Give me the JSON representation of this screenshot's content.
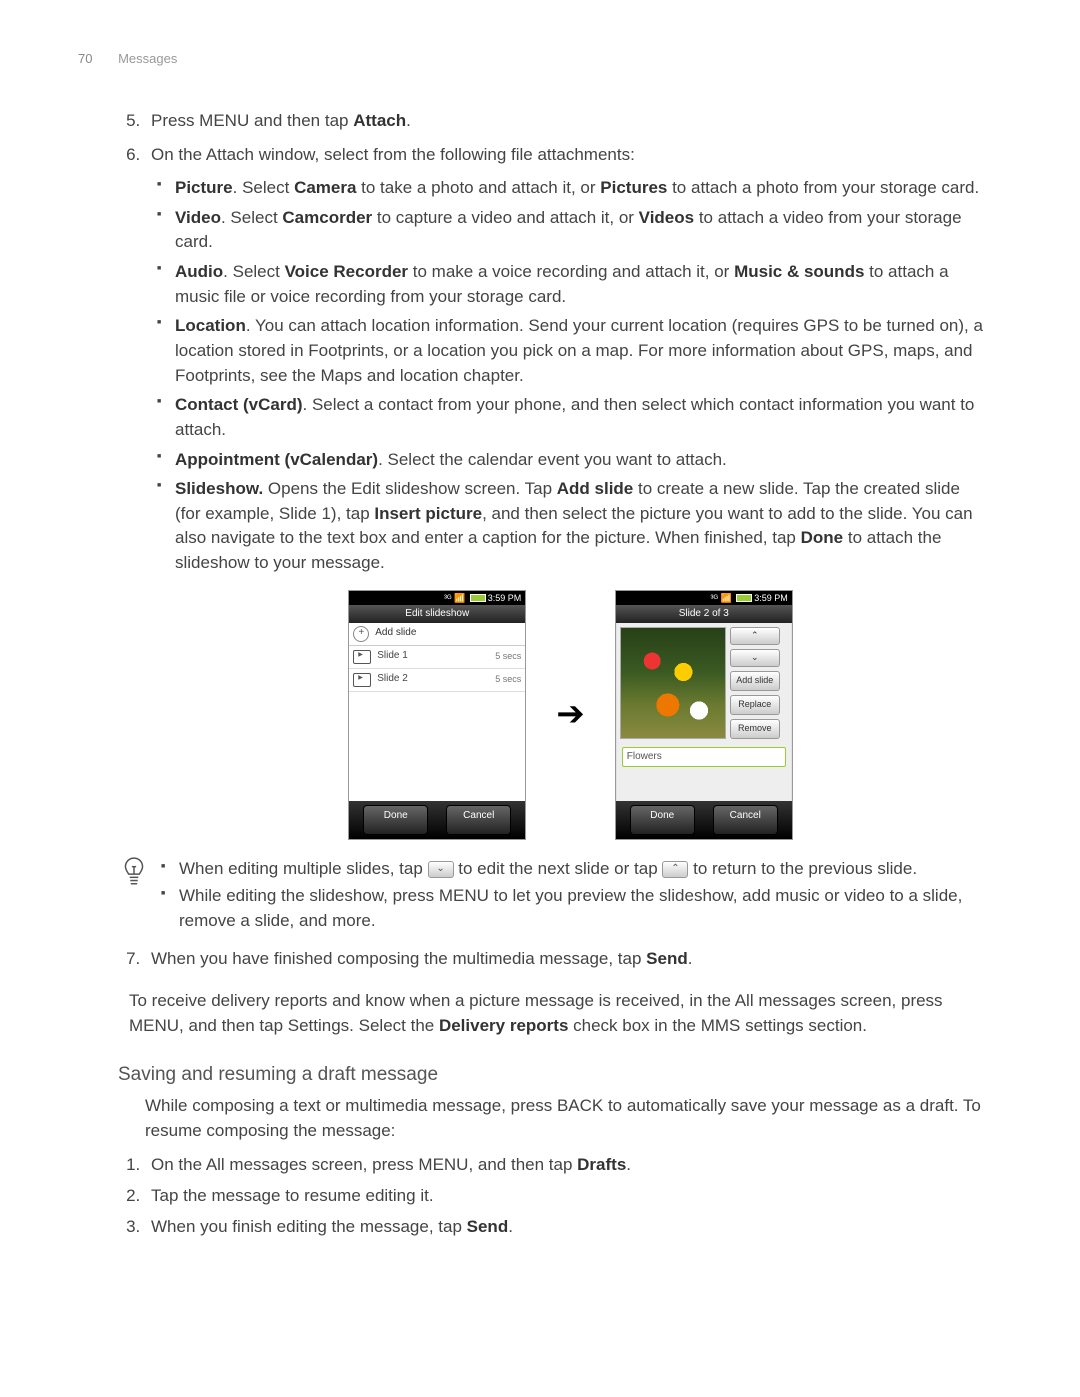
{
  "header": {
    "page_number": "70",
    "section": "Messages"
  },
  "steps": {
    "s5": {
      "pre": "Press MENU and then tap ",
      "b": "Attach",
      "post": "."
    },
    "s6": {
      "lead": "On the Attach window, select from the following file attachments:"
    },
    "attach": {
      "picture": {
        "b1": "Picture",
        "t1": ". Select ",
        "b2": "Camera",
        "t2": " to take a photo and attach it, or ",
        "b3": "Pictures",
        "t3": " to attach a photo from your storage card."
      },
      "video": {
        "b1": "Video",
        "t1": ". Select ",
        "b2": "Camcorder",
        "t2": " to capture a video and attach it, or ",
        "b3": "Videos",
        "t3": " to attach a video from your storage card."
      },
      "audio": {
        "b1": "Audio",
        "t1": ". Select ",
        "b2": "Voice Recorder",
        "t2": " to make a voice recording and attach it, or ",
        "b3": "Music & sounds",
        "t3": " to attach a music file or voice recording from your storage card."
      },
      "location": {
        "b1": "Location",
        "t1": ". You can attach location information. Send your current location (requires GPS to be turned on), a location stored in Footprints, or a location you pick on a map. For more information about GPS, maps, and Footprints, see the Maps and location chapter."
      },
      "contact": {
        "b1": "Contact (vCard)",
        "t1": ". Select a contact from your phone, and then select which contact information you want to attach."
      },
      "appt": {
        "b1": "Appointment (vCalendar)",
        "t1": ". Select the calendar event you want to attach."
      },
      "slideshow": {
        "b1": "Slideshow.",
        "t1": " Opens the Edit slideshow screen. Tap ",
        "b2": "Add slide",
        "t2": " to create a new slide. Tap the created slide (for example, Slide 1), tap ",
        "b3": "Insert picture",
        "t3": ", and then select the picture you want to add to the slide. You can also navigate to the text box and enter a caption for the picture. When finished, tap ",
        "b4": "Done",
        "t4": " to attach the slideshow to your message."
      }
    },
    "s7": {
      "pre": "When you have finished composing the multimedia message, tap ",
      "b": "Send",
      "post": "."
    }
  },
  "fig": {
    "clock": "3:59 PM",
    "left": {
      "title": "Edit slideshow",
      "add": "Add slide",
      "r1_name": "Slide 1",
      "r1_secs": "5 secs",
      "r2_name": "Slide 2",
      "r2_secs": "5 secs",
      "done": "Done",
      "cancel": "Cancel"
    },
    "right": {
      "title": "Slide 2 of 3",
      "up": "⌃",
      "down": "⌄",
      "add": "Add slide",
      "replace": "Replace",
      "remove": "Remove",
      "text": "Flowers",
      "done": "Done",
      "cancel": "Cancel"
    }
  },
  "tips": {
    "t1a": "When editing multiple slides, tap ",
    "t1b": " to edit the next slide or tap ",
    "t1c": " to return to the previous slide.",
    "t2": "While editing the slideshow, press MENU to let you preview the slideshow, add music or video to a slide, remove a slide, and more."
  },
  "note": {
    "a": "To receive delivery reports and know when a picture message is received, in the All messages screen, press MENU, and then tap Settings. Select the ",
    "b": "Delivery reports",
    "c": " check box in the MMS settings section."
  },
  "draft": {
    "heading": "Saving and resuming a draft message",
    "para": "While composing a text or multimedia message, press BACK to automatically save your message as a draft. To resume composing the message:",
    "s1": {
      "pre": "On the All messages screen, press MENU, and then tap ",
      "b": "Drafts",
      "post": "."
    },
    "s2": "Tap the message to resume editing it.",
    "s3": {
      "pre": "When you finish editing the message, tap ",
      "b": "Send",
      "post": "."
    }
  }
}
